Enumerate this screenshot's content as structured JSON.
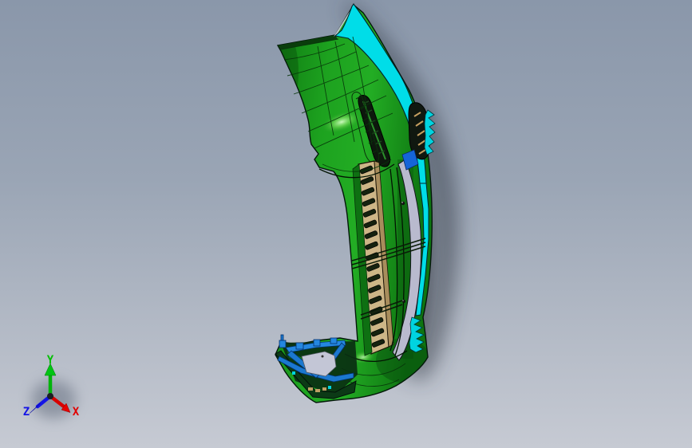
{
  "triad": {
    "x": {
      "label": "X",
      "color": "#e10000"
    },
    "y": {
      "label": "Y",
      "color": "#00bf00"
    },
    "z": {
      "label": "Z",
      "color": "#1414e6"
    }
  },
  "scene": {
    "background": {
      "top": "#8a97aa",
      "bottom": "#c6cad3"
    },
    "model": {
      "body_color": "#1ea21e",
      "trim_color": "#00dde8",
      "grille_color": "#cdb687",
      "grille_slot_color": "#15220f",
      "clip_color": "#1d7ad2",
      "side_panel_color": "#b9bace",
      "accent_patch_color": "#1565d8",
      "shadow_color": "#2e3440"
    }
  }
}
